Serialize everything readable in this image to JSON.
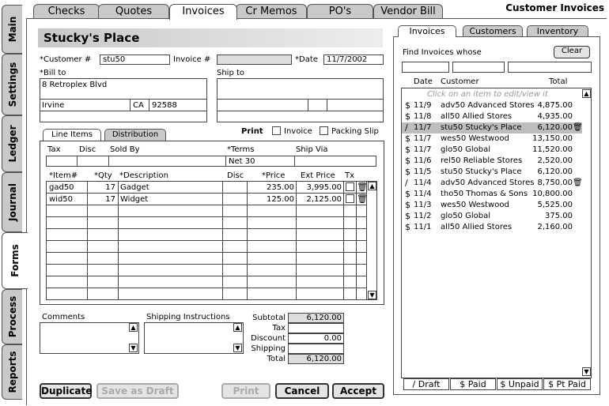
{
  "app": {
    "title": "Customer Invoices"
  },
  "top_tabs": [
    "Checks",
    "Quotes",
    "Invoices",
    "Cr Memos",
    "PO's",
    "Vendor Bill"
  ],
  "side_tabs": [
    "Main",
    "Settings",
    "Ledger",
    "Journal",
    "Forms",
    "Process",
    "Reports"
  ],
  "form": {
    "customer_name": "Stucky's Place",
    "customer_label": "*Customer #",
    "customer_value": "stu50",
    "invoice_label": "Invoice #",
    "invoice_value": "",
    "date_label": "*Date",
    "date_value": "11/7/2002",
    "bill_to_label": "*Bill to",
    "bill_to_address": "8 Retroplex Blvd",
    "bill_to_city": "Irvine",
    "bill_to_state": "CA",
    "bill_to_zip": "92588",
    "ship_to_label": "Ship to"
  },
  "subtabs": {
    "line_items": "Line Items",
    "distribution": "Distribution"
  },
  "print_opts": {
    "label": "Print",
    "invoice": "Invoice",
    "packing_slip": "Packing Slip"
  },
  "terms": {
    "tax_label": "Tax",
    "disc_label": "Disc",
    "sold_by_label": "Sold By",
    "terms_label": "*Terms",
    "ship_via_label": "Ship Via",
    "terms_value": "Net 30"
  },
  "items": {
    "headers": {
      "item": "*Item#",
      "qty": "*Qty",
      "desc": "*Description",
      "disc": "Disc",
      "price": "*Price",
      "ext": "Ext Price",
      "tx": "Tx"
    },
    "rows": [
      {
        "item": "gad50",
        "qty": "17",
        "desc": "Gadget",
        "price": "235.00",
        "ext": "3,995.00"
      },
      {
        "item": "wid50",
        "qty": "17",
        "desc": "Widget",
        "price": "125.00",
        "ext": "2,125.00"
      }
    ]
  },
  "comments_label": "Comments",
  "shipping_label": "Shipping Instructions",
  "totals": {
    "subtotal_label": "Subtotal",
    "subtotal": "6,120.00",
    "tax_label": "Tax",
    "tax": "",
    "discount_label": "Discount",
    "discount": "0.00",
    "shipping_label": "Shipping",
    "shipping": "",
    "total_label": "Total",
    "total": "6,120.00"
  },
  "buttons": {
    "duplicate": "Duplicate",
    "save_draft": "Save as Draft",
    "print": "Print",
    "cancel": "Cancel",
    "accept": "Accept"
  },
  "right_panel": {
    "tabs": [
      "Invoices",
      "Customers",
      "Inventory"
    ],
    "find_label": "Find Invoices whose",
    "clear": "Clear",
    "col_date": "Date",
    "col_customer": "Customer",
    "col_total": "Total",
    "hint": "Click on an item to edit/view it",
    "invoices": [
      {
        "icon": "$",
        "date": "11/9",
        "customer": "adv50 Advanced Stores",
        "total": "4,875.00",
        "trash": false
      },
      {
        "icon": "$",
        "date": "11/8",
        "customer": "all50 Allied Stores",
        "total": "4,935.00",
        "trash": false
      },
      {
        "icon": "/",
        "date": "11/7",
        "customer": "stu50 Stucky's Place",
        "total": "6,120.00",
        "trash": true,
        "selected": true
      },
      {
        "icon": "$",
        "date": "11/7",
        "customer": "wes50 Westwood",
        "total": "13,150.00",
        "trash": false
      },
      {
        "icon": "$",
        "date": "11/7",
        "customer": "glo50 Global",
        "total": "11,520.00",
        "trash": false
      },
      {
        "icon": "$",
        "date": "11/6",
        "customer": "rel50 Reliable Stores",
        "total": "2,520.00",
        "trash": false
      },
      {
        "icon": "$",
        "date": "11/5",
        "customer": "stu50 Stucky's Place",
        "total": "6,120.00",
        "trash": false
      },
      {
        "icon": "/",
        "date": "11/4",
        "customer": "adv50 Advanced Stores",
        "total": "8,750.00",
        "trash": true
      },
      {
        "icon": "$",
        "date": "11/4",
        "customer": "tho50 Thomas & Sons",
        "total": "10,800.00",
        "trash": false
      },
      {
        "icon": "$",
        "date": "11/3",
        "customer": "wes50 Westwood",
        "total": "5,525.00",
        "trash": false
      },
      {
        "icon": "$",
        "date": "11/2",
        "customer": "glo50 Global",
        "total": "375.00",
        "trash": false
      },
      {
        "icon": "$",
        "date": "11/1",
        "customer": "all50 Allied Stores",
        "total": "2,160.00",
        "trash": false
      }
    ],
    "filters": [
      "/ Draft",
      "$ Paid",
      "$ Unpaid",
      "$ Pt Paid"
    ]
  }
}
